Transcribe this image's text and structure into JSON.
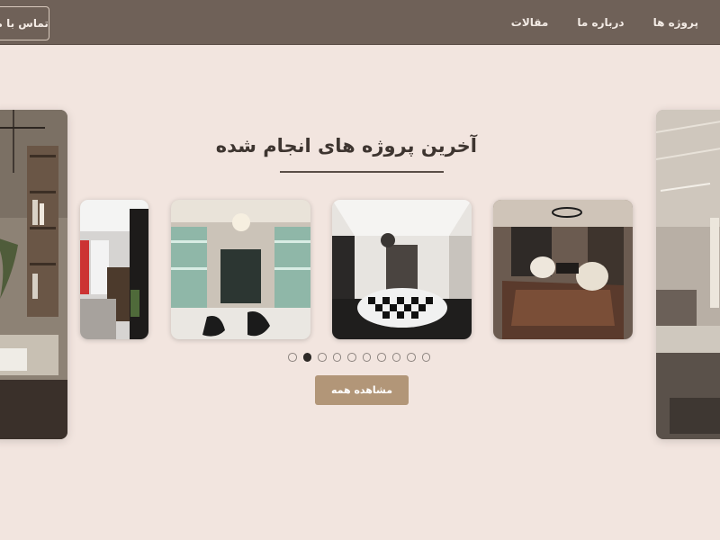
{
  "header": {
    "contact_label": "تماس با ما",
    "nav": [
      {
        "label": "پروژه ها"
      },
      {
        "label": "درباره ما"
      },
      {
        "label": "مقالات"
      }
    ]
  },
  "section": {
    "title": "آخرین پروژه های انجام شده"
  },
  "carousel": {
    "total_dots": 10,
    "active_dot_index": 1
  },
  "view_all_label": "مشاهده همه",
  "colors": {
    "header_bg": "#6f6158",
    "page_bg": "#f2e5df",
    "button_bg": "#b29678",
    "active_dot": "#2e2a27"
  }
}
